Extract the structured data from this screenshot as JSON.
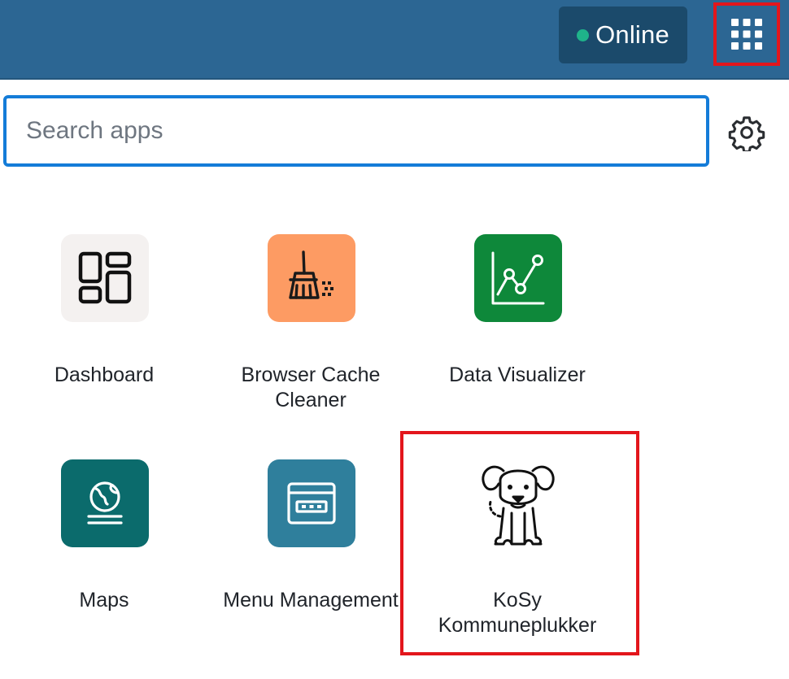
{
  "header": {
    "status_label": "Online",
    "status_color": "#1fb38a",
    "bar_color": "#2c6693",
    "apps_button_icon": "grid-icon"
  },
  "search": {
    "placeholder": "Search apps",
    "value": "",
    "settings_icon": "gear-icon"
  },
  "apps": [
    {
      "label": "Dashboard",
      "icon": "dashboard-icon",
      "bg": "#f4f1f0"
    },
    {
      "label": "Browser Cache Cleaner",
      "icon": "broom-icon",
      "bg": "#fd9b63"
    },
    {
      "label": "Data Visualizer",
      "icon": "line-chart-icon",
      "bg": "#0e883a"
    },
    {
      "label": "Maps",
      "icon": "globe-icon",
      "bg": "#0b6b6c"
    },
    {
      "label": "Menu Management",
      "icon": "window-icon",
      "bg": "#2f7f9c"
    },
    {
      "label": "KoSy Kommuneplukker",
      "icon": "dog-icon",
      "bg": "#ffffff"
    }
  ],
  "highlight_color": "#e3161c"
}
